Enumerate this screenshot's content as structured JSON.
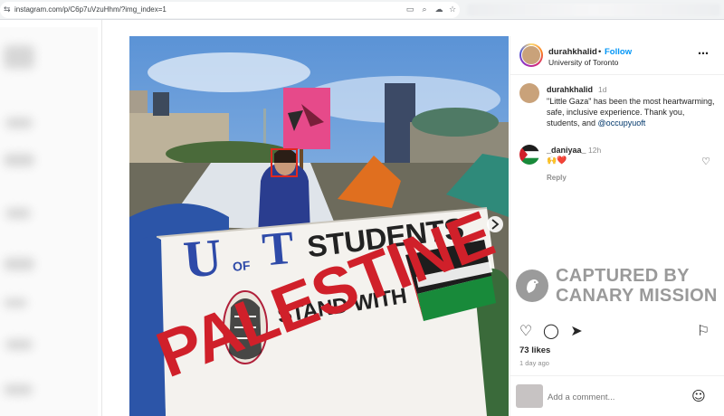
{
  "browser": {
    "url": "instagram.com/p/C6p7uVzuHhm/?img_index=1",
    "site_icon": "site-info-icon",
    "toolbar_icons": [
      "cast-icon",
      "zoom-icon",
      "extension-icon",
      "bookmark-star-icon"
    ]
  },
  "post": {
    "header": {
      "username": "durahkhalid",
      "dot": "•",
      "follow_label": "Follow",
      "location": "University of Toronto",
      "more_icon": "more-options-icon"
    },
    "caption": {
      "username": "durahkhalid",
      "time": "1d",
      "text_prefix": "\"Little Gaza\" has been the most heartwarming, safe, inclusive experience. Thank you, students, and ",
      "mention": "@occupyuoft"
    },
    "comment": {
      "username": "_daniyaa_",
      "time": "12h",
      "text": "🙌❤️",
      "reply_label": "Reply",
      "like_icon": "heart-outline-icon"
    },
    "photo": {
      "banner_line1_u": "U",
      "banner_line1_of": "OF",
      "banner_line1_t": "T",
      "banner_line1_students": "STUDENTS",
      "banner_line2": "STAND WITH",
      "banner_line3": "PALESTINE",
      "sign_color": "#e64a8a",
      "banner_blue": "#2e4aa8",
      "banner_red": "#d0202a",
      "next_icon": "chevron-right-icon"
    },
    "actions": {
      "like_icon": "heart-icon",
      "comment_icon": "comment-icon",
      "share_icon": "share-icon",
      "save_icon": "bookmark-icon"
    },
    "likes": "73 likes",
    "posted_ago": "1 day ago",
    "add_comment_placeholder": "Add a comment...",
    "emoji_icon": "emoji-icon"
  },
  "watermark": {
    "line1": "CAPTURED BY",
    "line2": "CANARY MISSION",
    "logo_icon": "canary-bird-icon"
  }
}
